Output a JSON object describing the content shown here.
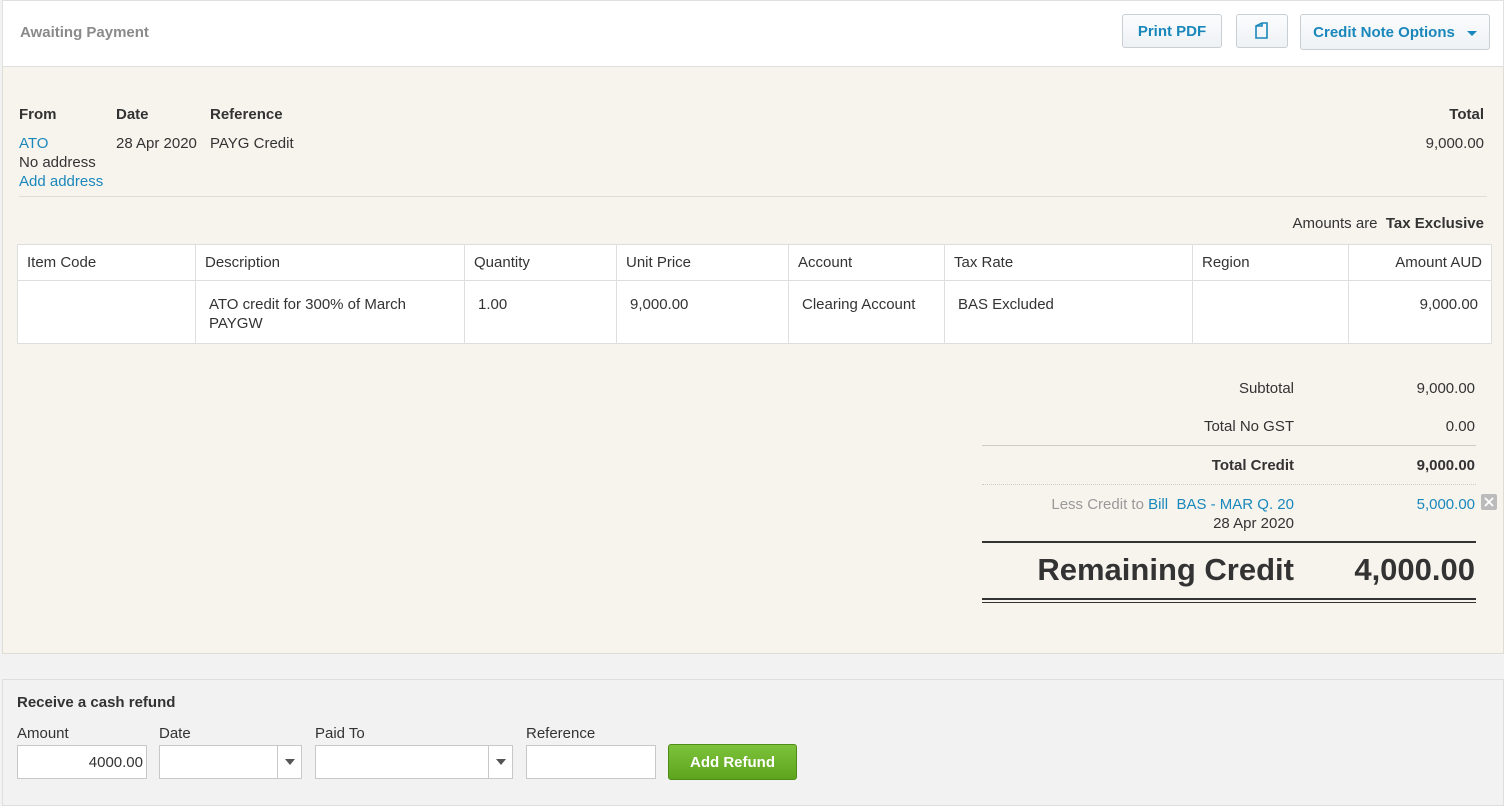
{
  "header": {
    "status": "Awaiting Payment",
    "print_pdf": "Print PDF",
    "copy_icon": "copy-icon",
    "options": "Credit Note Options"
  },
  "details": {
    "from_label": "From",
    "date_label": "Date",
    "reference_label": "Reference",
    "total_label": "Total",
    "from_name": "ATO",
    "no_address": "No address",
    "add_address": "Add address",
    "date": "28 Apr 2020",
    "reference": "PAYG Credit",
    "total": "9,000.00"
  },
  "amounts": {
    "prefix": "Amounts are",
    "mode": "Tax Exclusive"
  },
  "table": {
    "headers": {
      "item_code": "Item Code",
      "description": "Description",
      "quantity": "Quantity",
      "unit_price": "Unit Price",
      "account": "Account",
      "tax_rate": "Tax Rate",
      "region": "Region",
      "amount": "Amount AUD"
    },
    "rows": [
      {
        "item_code": "",
        "description": "ATO credit for 300% of March PAYGW",
        "quantity": "1.00",
        "unit_price": "9,000.00",
        "account": "Clearing Account",
        "tax_rate": "BAS Excluded",
        "region": "",
        "amount": "9,000.00"
      }
    ]
  },
  "totals": {
    "subtotal_label": "Subtotal",
    "subtotal": "9,000.00",
    "gst_label": "Total No GST",
    "gst": "0.00",
    "total_credit_label": "Total Credit",
    "total_credit": "9,000.00",
    "less_prefix": "Less Credit to",
    "bill_link": "Bill",
    "bill_ref": "BAS - MAR Q. 20",
    "less_date": "28 Apr 2020",
    "less_amount": "5,000.00",
    "remaining_label": "Remaining Credit",
    "remaining": "4,000.00"
  },
  "refund": {
    "title": "Receive a cash refund",
    "amount_label": "Amount",
    "amount_value": "4000.00",
    "date_label": "Date",
    "date_value": "",
    "paid_to_label": "Paid To",
    "paid_to_value": "",
    "reference_label": "Reference",
    "reference_value": "",
    "add_button": "Add Refund"
  }
}
